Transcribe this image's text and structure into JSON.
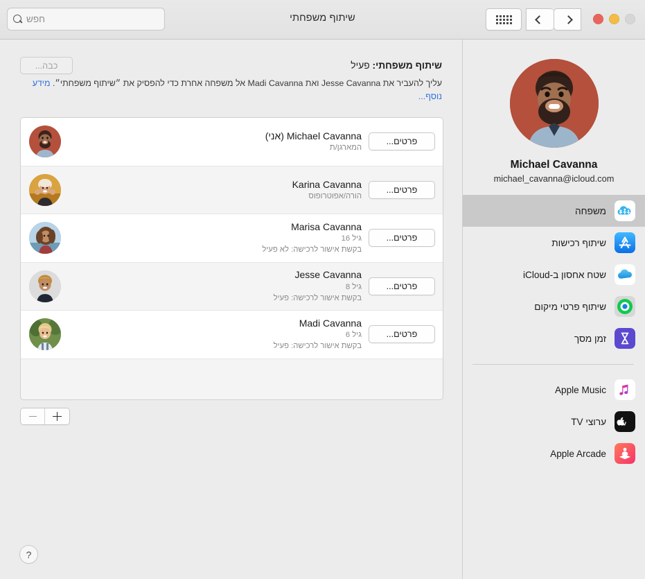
{
  "window": {
    "title": "שיתוף משפחתי",
    "traffic_lights": [
      "close-red",
      "minimize-yellow",
      "zoom-disabled-gray"
    ]
  },
  "toolbar": {
    "search_placeholder": "חפש",
    "search_value": "",
    "search_icon": "search-icon",
    "grid_icon": "grid-view-icon",
    "back_icon": "chevron-left-icon",
    "forward_icon": "chevron-right-icon"
  },
  "main": {
    "status_label": "שיתוף משפחתי:",
    "status_value": "פעיל",
    "description_line1": "עליך להעביר את Jesse Cavanna ואת Madi Cavanna אל משפחה אחרת כדי",
    "description_line2": "להפסיק את ״שיתוף משפחתי״.",
    "learn_more": "מידע נוסף...",
    "turn_off_button": "כבה...",
    "details_button": "פרטים...",
    "remove_button_icon": "minus-icon",
    "add_button_icon": "plus-icon",
    "help_button": "?",
    "members": [
      {
        "name": "Michael Cavanna (אני)",
        "role": "המארגן/ת",
        "status": "",
        "avatar": "avatar-michael"
      },
      {
        "name": "Karina Cavanna",
        "role": "הורה/אפוטרופוס",
        "status": "",
        "avatar": "avatar-karina"
      },
      {
        "name": "Marisa Cavanna",
        "role": "גיל 16",
        "status": "בקשת אישור לרכישה: לא פעיל",
        "avatar": "avatar-marisa"
      },
      {
        "name": "Jesse Cavanna",
        "role": "גיל 8",
        "status": "בקשת אישור לרכישה: פעיל",
        "avatar": "avatar-jesse"
      },
      {
        "name": "Madi Cavanna",
        "role": "גיל 6",
        "status": "בקשת אישור לרכישה: פעיל",
        "avatar": "avatar-madi"
      }
    ]
  },
  "sidebar": {
    "profile_name": "Michael Cavanna",
    "profile_email": "michael_cavanna@icloud.com",
    "profile_avatar": "avatar-michael-large",
    "items_top": [
      {
        "label": "משפחה",
        "icon": "family-sharing-icon",
        "selected": true
      },
      {
        "label": "שיתוף רכישות",
        "icon": "app-store-icon",
        "selected": false
      },
      {
        "label": "שטח אחסון ב-iCloud",
        "icon": "icloud-icon",
        "selected": false
      },
      {
        "label": "שיתוף פרטי מיקום",
        "icon": "find-my-icon",
        "selected": false
      },
      {
        "label": "זמן מסך",
        "icon": "screen-time-icon",
        "selected": false
      }
    ],
    "items_bottom": [
      {
        "label": "Apple Music",
        "icon": "apple-music-icon",
        "selected": false
      },
      {
        "label": "ערוצי TV",
        "icon": "apple-tv-icon",
        "selected": false
      },
      {
        "label": "Apple Arcade",
        "icon": "apple-arcade-icon",
        "selected": false
      }
    ]
  },
  "colors": {
    "window_bg": "#ececec",
    "list_row_alt": "#f4f4f4",
    "selection": "#c9c9c9",
    "link": "#2f6fdd",
    "text_primary": "#1b1b1b",
    "text_secondary": "#8a8a8a"
  }
}
